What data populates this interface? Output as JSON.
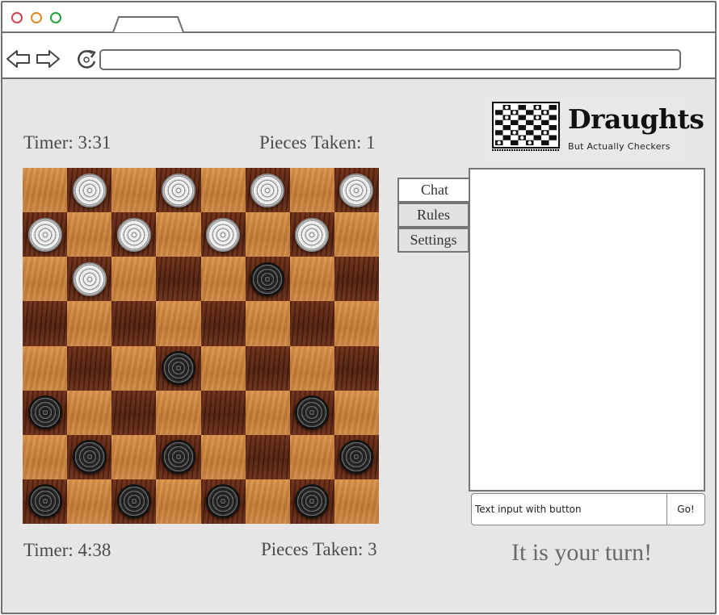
{
  "browser": {
    "address_value": ""
  },
  "opponent": {
    "timer": "Timer: 3:31",
    "pieces_taken": "Pieces Taken: 1"
  },
  "player": {
    "timer": "Timer: 4:38",
    "pieces_taken": "Pieces Taken: 3"
  },
  "logo": {
    "title": "Draughts",
    "subtitle": "But Actually Checkers"
  },
  "tabs": [
    {
      "label": "Chat",
      "active": true
    },
    {
      "label": "Rules",
      "active": false
    },
    {
      "label": "Settings",
      "active": false
    }
  ],
  "chat": {
    "input_value": "Text input with button",
    "button_label": "Go!"
  },
  "status_message": "It is your turn!",
  "board": {
    "rows": [
      "LWLWLWLW",
      "WLWLWLWL",
      "LWLDLBLD",
      "DLDLDLDL",
      "LDLBLDLD",
      "BLDLDLBL",
      "LBLBLDLB",
      "BLBLBLBL"
    ],
    "legend": {
      "L": "light-square",
      "D": "dark-square",
      "W": "white-piece",
      "B": "black-piece"
    }
  },
  "colors": {
    "chrome_border": "#6e6e6e",
    "canvas_bg": "#e6e6e6",
    "text_gray": "#4a4a4a",
    "traffic_red": "#d0454f",
    "traffic_orange": "#de8a22",
    "traffic_green": "#21a33a"
  }
}
